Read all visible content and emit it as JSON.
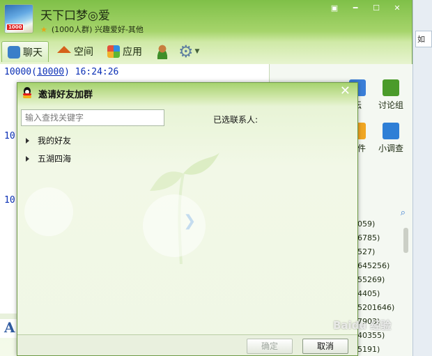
{
  "group_window": {
    "title": "天下口梦◎爱",
    "subtitle": "(1000人群) 兴趣爱好-其他",
    "avatar_badge": "1000",
    "window_buttons": [
      "▣",
      "━",
      "☐",
      "✕"
    ],
    "tabs": [
      {
        "label": "聊天",
        "icon": "chat-icon"
      },
      {
        "label": "空间",
        "icon": "home-icon"
      },
      {
        "label": "应用",
        "icon": "apps-icon"
      }
    ],
    "chat_lines": [
      {
        "prefix": "10000(",
        "link": "10000",
        "suffix": ")  16:24:26"
      },
      {
        "text": "10"
      },
      {
        "text": "10"
      }
    ],
    "chat_letter": "A",
    "apps": [
      {
        "label": "坛"
      },
      {
        "label": "讨论组"
      },
      {
        "label": "事件"
      },
      {
        "label": "小调查"
      }
    ],
    "members": [
      "059)",
      "6785)",
      "527)",
      "645256)",
      "55269)",
      "4405)",
      "5201646)",
      "7903)",
      "40355)",
      "5191)"
    ],
    "edge_text": "如"
  },
  "dialog": {
    "title": "邀请好友加群",
    "close_glyph": "✕",
    "search_placeholder": "输入查找关键字",
    "tree": [
      {
        "label": "我的好友"
      },
      {
        "label": "五湖四海"
      }
    ],
    "selected_label": "已选联系人:",
    "transfer_glyph": "❯",
    "ok_label": "确定",
    "cancel_label": "取消"
  },
  "watermark": "Baidu 经验",
  "colors": {
    "accent_green": "#8cc552",
    "link_blue": "#0a2fb5",
    "scarf_red": "#e41c1c"
  }
}
